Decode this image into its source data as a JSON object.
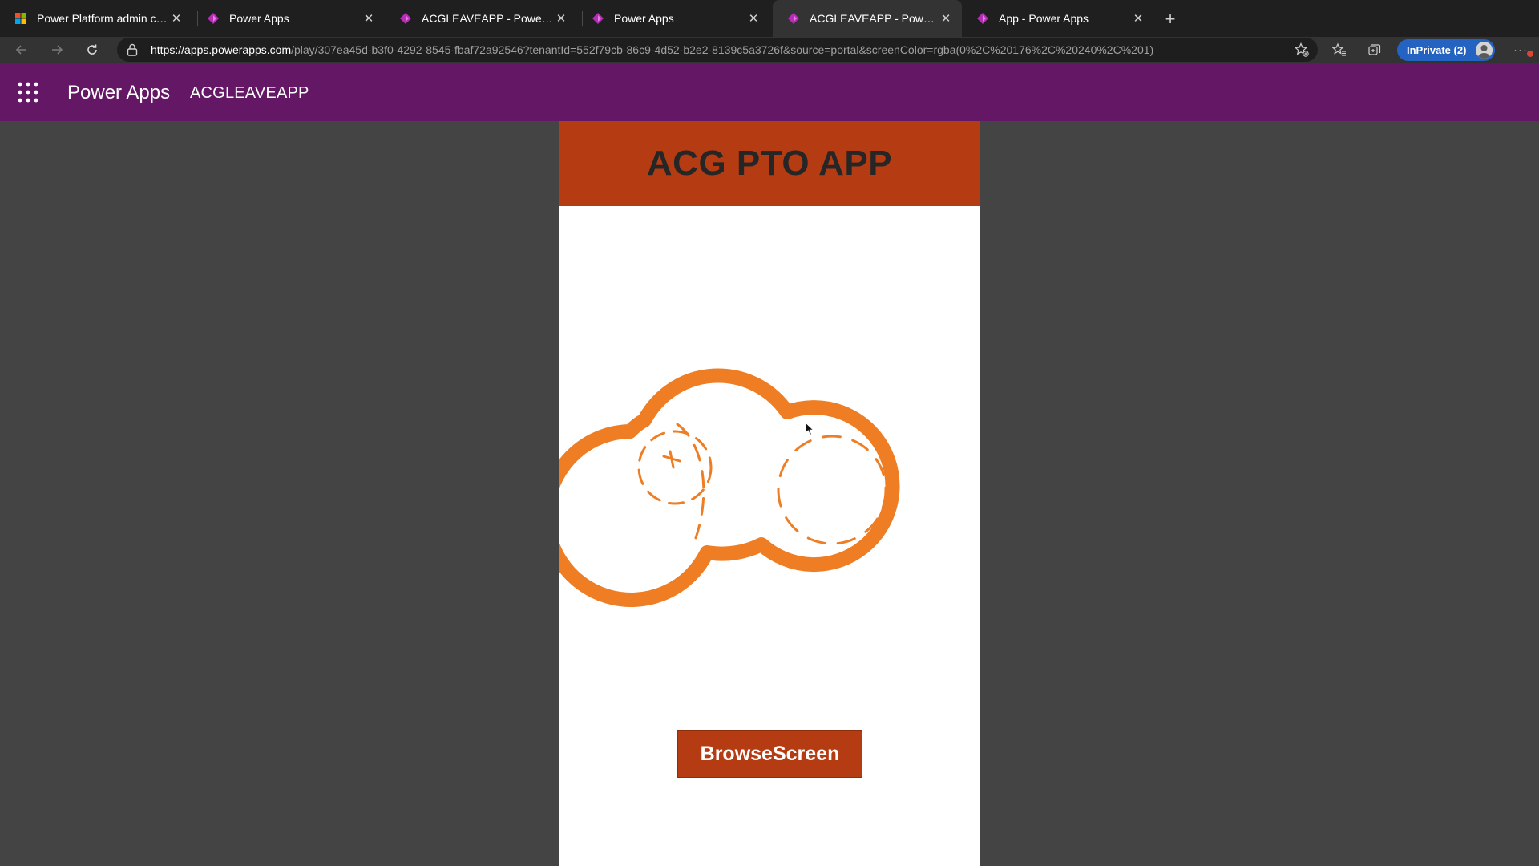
{
  "browser": {
    "tabs": [
      {
        "title": "Power Platform admin center",
        "favicon": "microsoft-logo-icon",
        "active": false
      },
      {
        "title": "Power Apps",
        "favicon": "power-apps-icon",
        "active": false
      },
      {
        "title": "ACGLEAVEAPP - Power Apps",
        "favicon": "power-apps-icon",
        "active": false
      },
      {
        "title": "Power Apps",
        "favicon": "power-apps-icon",
        "active": false
      },
      {
        "title": "ACGLEAVEAPP - Power Apps",
        "favicon": "power-apps-icon",
        "active": true
      },
      {
        "title": "App - Power Apps",
        "favicon": "power-apps-icon",
        "active": false
      }
    ],
    "tab_close_glyph": "✕",
    "new_tab_glyph": "+",
    "address": {
      "scheme": "https://",
      "host": "apps.powerapps.com",
      "path": "/play/307ea45d-b3f0-4292-8545-fbaf72a92546?tenantId=552f79cb-86c9-4d52-b2e2-8139c5a3726f&source=portal&screenColor=rgba(0%2C%20176%2C%20240%2C%201)"
    },
    "inprivate_label": "InPrivate (2)",
    "more_glyph": "···"
  },
  "header": {
    "brand": "Power Apps",
    "app_name": "ACGLEAVEAPP"
  },
  "app": {
    "title": "ACG PTO APP",
    "button_label": "BrowseScreen"
  },
  "colors": {
    "header_purple": "#641764",
    "app_accent": "#b53c12",
    "cloud_orange": "#ee7d23",
    "backdrop": "#444444"
  }
}
